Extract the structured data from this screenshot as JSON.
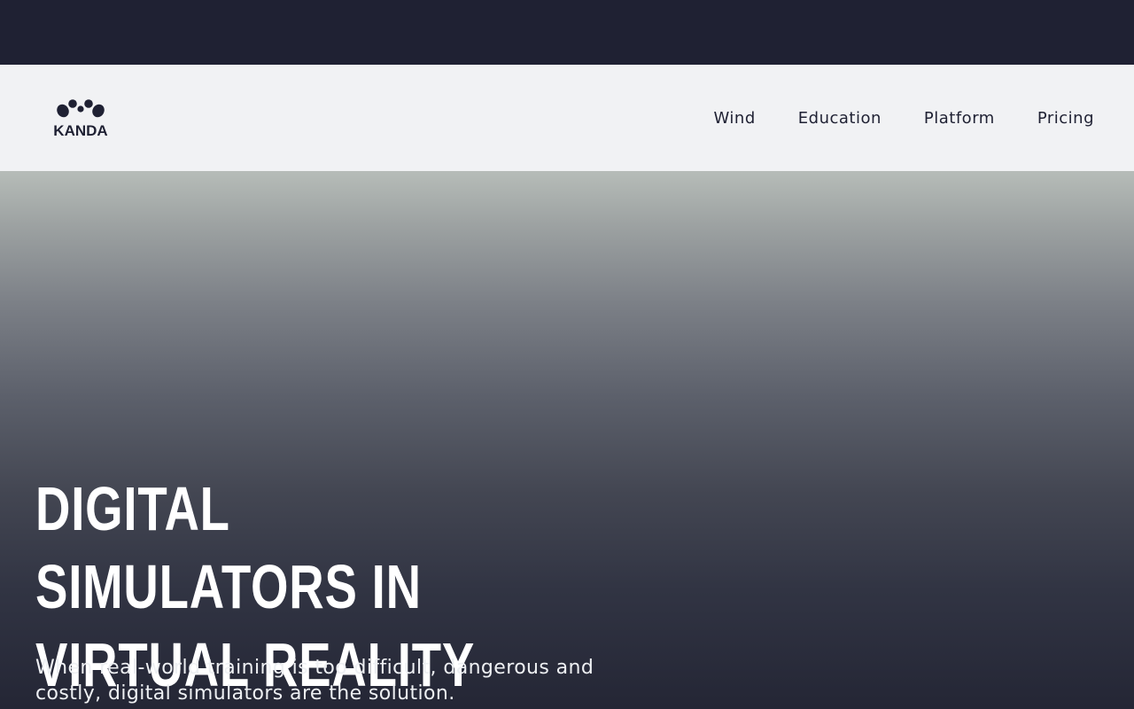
{
  "brand": {
    "logo_text": "KANDA"
  },
  "nav": {
    "items": [
      {
        "label": "Wind"
      },
      {
        "label": "Education"
      },
      {
        "label": "Platform"
      },
      {
        "label": "Pricing"
      }
    ]
  },
  "hero": {
    "title": "DIGITAL SIMULATORS IN VIRTUAL REALITY",
    "subtitle": "When real-world training is too difficult, dangerous and costly, digital simulators are the solution."
  },
  "colors": {
    "brand_dark": "#1f2133",
    "header_bg": "#f1f2f4",
    "hero_text": "#ffffff"
  }
}
